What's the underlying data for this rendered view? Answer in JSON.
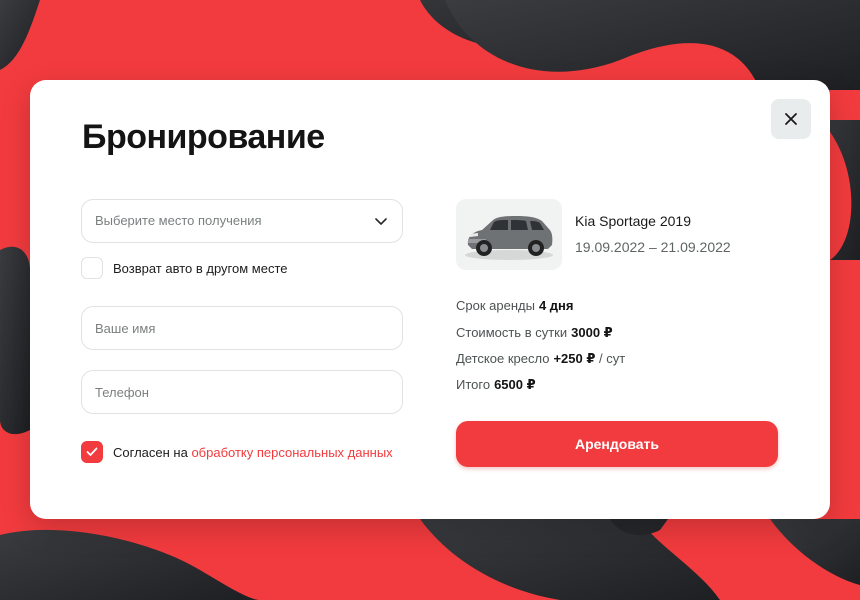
{
  "modal": {
    "title": "Бронирование",
    "close_icon": "close-icon"
  },
  "form": {
    "pickup_placeholder": "Выберите место получения",
    "return_other_label": "Возврат авто в другом месте",
    "return_other_checked": false,
    "name_placeholder": "Ваше имя",
    "phone_placeholder": "Телефон",
    "consent_text": "Согласен на",
    "consent_link": "обработку персональных данных",
    "consent_checked": true
  },
  "summary": {
    "car_name": "Kia Sportage 2019",
    "dates": "19.09.2022 – 21.09.2022",
    "rows": [
      {
        "label": "Срок аренды",
        "value": "4 дня",
        "suffix": ""
      },
      {
        "label": "Стоимость в сутки",
        "value": "3000 ₽",
        "suffix": ""
      },
      {
        "label": "Детское кресло",
        "value": "+250 ₽",
        "suffix": "/ сут"
      },
      {
        "label": "Итого",
        "value": "6500 ₽",
        "suffix": ""
      }
    ],
    "rent_button": "Арендовать"
  },
  "colors": {
    "accent": "#f23b3e",
    "background_swirl": "#2b2d30"
  }
}
